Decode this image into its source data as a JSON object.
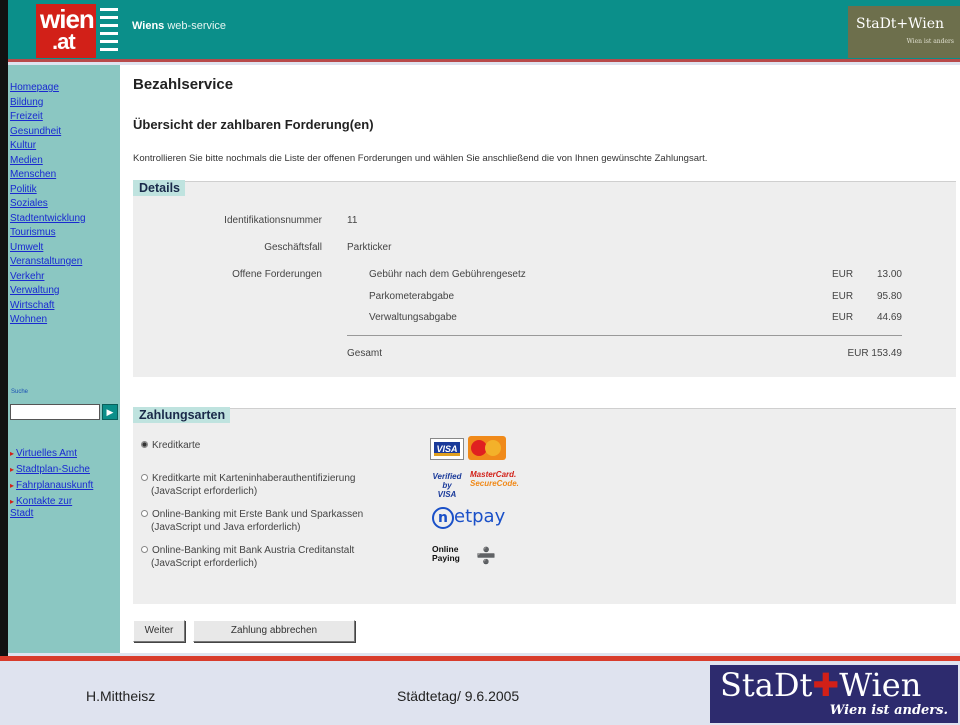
{
  "header": {
    "logo_top": "wien",
    "logo_bottom": ".at",
    "title_bold": "Wiens",
    "title_rest": "web-service",
    "badge_name": "StaDt+Wien",
    "badge_sub": "Wien ist anders"
  },
  "sidebar": {
    "nav": [
      "Homepage",
      "Bildung",
      "Freizeit",
      "Gesundheit",
      "Kultur",
      "Medien",
      "Menschen",
      "Politik",
      "Soziales",
      "Stadtentwicklung",
      "Tourismus",
      "Umwelt",
      "Veranstaltungen",
      "Verkehr",
      "Verwaltung",
      "Wirtschaft",
      "Wohnen"
    ],
    "search_label": "Suche",
    "search_go": "▶",
    "links": [
      {
        "line1": "Virtuelles Amt",
        "line2": ""
      },
      {
        "line1": "Stadtplan-Suche",
        "line2": ""
      },
      {
        "line1": "Fahrplanauskunft",
        "line2": ""
      },
      {
        "line1": "Kontakte zur",
        "line2": "Stadt"
      }
    ]
  },
  "main": {
    "title": "Bezahlservice",
    "subtitle": "Übersicht der zahlbaren Forderung(en)",
    "intro": "Kontrollieren Sie bitte nochmals die Liste der offenen Forderungen und wählen Sie anschließend die von Ihnen gewünschte Zahlungsart.",
    "details": {
      "heading": "Details",
      "id_label": "Identifikationsnummer",
      "id_value": "11",
      "case_label": "Geschäftsfall",
      "case_value": "Parkticker",
      "open_label": "Offene Forderungen",
      "items": [
        {
          "name": "Gebühr nach dem Gebührengesetz",
          "currency": "EUR",
          "amount": "13.00"
        },
        {
          "name": "Parkometerabgabe",
          "currency": "EUR",
          "amount": "95.80"
        },
        {
          "name": "Verwaltungsabgabe",
          "currency": "EUR",
          "amount": "44.69"
        }
      ],
      "total_label": "Gesamt",
      "total_value": "EUR 153.49"
    },
    "payment": {
      "heading": "Zahlungsarten",
      "options": [
        {
          "line1": "Kreditkarte",
          "line2": "",
          "selected": true
        },
        {
          "line1": "Kreditkarte mit Karteninhaberauthentifizierung",
          "line2": "(JavaScript erforderlich)",
          "selected": false
        },
        {
          "line1": "Online-Banking mit Erste Bank und Sparkassen",
          "line2": "(JavaScript und Java erforderlich)",
          "selected": false
        },
        {
          "line1": "Online-Banking mit Bank Austria Creditanstalt",
          "line2": "(JavaScript erforderlich)",
          "selected": false
        }
      ],
      "logos": {
        "visa": "VISA",
        "vbv_line1": "Verified",
        "vbv_line2": "by VISA",
        "mc_line1": "MasterCard.",
        "mc_line2": "SecureCode.",
        "netpay_n": "n",
        "netpay_rest": "etpay",
        "op_line1": "Online",
        "op_line2": "Paying"
      }
    },
    "buttons": {
      "next": "Weiter",
      "cancel": "Zahlung abbrechen"
    }
  },
  "footer": {
    "author": "H.Mittheisz",
    "event": "Städtetag/ 9.6.2005",
    "logo_name_a": "StaDt",
    "logo_cross": "✚",
    "logo_name_b": "Wien",
    "logo_sub": "Wien ist anders."
  },
  "colors": {
    "header_teal": "#0b8f8a",
    "sidebar_teal": "#8bc7c2",
    "brand_red": "#d22018",
    "footer_navy": "#2d2b6e"
  }
}
